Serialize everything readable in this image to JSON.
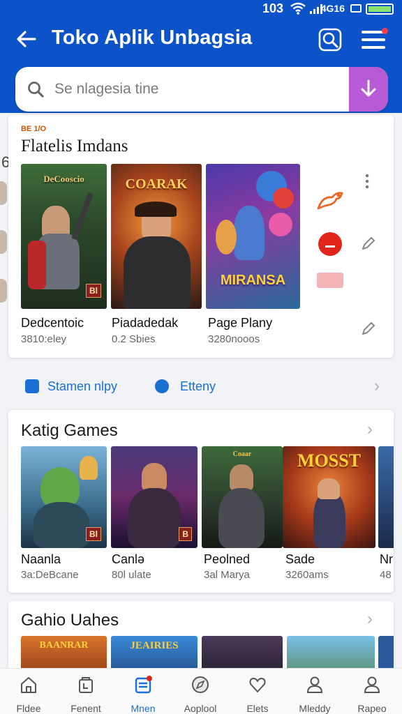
{
  "status_bar": {
    "time": "103",
    "network": "4G16"
  },
  "header": {
    "title": "Toko Aplik Unbagsia",
    "search_placeholder": "Se nlagesia tine"
  },
  "section_featured": {
    "tag": "BE 1/O",
    "title": "Flatelis Imdans",
    "apps": [
      {
        "name": "Dedcentoic",
        "sub": "3810:eley",
        "banner": "DeCooscio",
        "badge": "Bl"
      },
      {
        "name": "Piadadedak",
        "sub": "0.2 Sbies",
        "banner": "COARAK"
      },
      {
        "name": "Page Plany",
        "sub": "3280nooos",
        "banner": "MIRANSA"
      }
    ]
  },
  "tabs": [
    {
      "label": "Stamen nlpy"
    },
    {
      "label": "Etteny"
    }
  ],
  "section_games": {
    "title": "Katig Games",
    "apps": [
      {
        "name": "Naanla",
        "sub": "3a:DeBcane",
        "badge": "Bl"
      },
      {
        "name": "Canlə",
        "sub": "80l ulate",
        "badge": "B"
      },
      {
        "name": "Peolned",
        "sub": "3al Marya",
        "banner": "Coaar"
      },
      {
        "name": "Sade",
        "sub": "3260ams",
        "banner": "MOSST"
      },
      {
        "name": "Nr",
        "sub": "48"
      }
    ]
  },
  "section_gahio": {
    "title": "Gahio Uahes",
    "tiles": [
      {
        "banner": "BAANRAR"
      },
      {
        "banner": "JEAIRIES"
      },
      {
        "banner": ""
      },
      {
        "banner": ""
      }
    ]
  },
  "bottom_nav": [
    {
      "label": "Fldee",
      "icon": "home-icon"
    },
    {
      "label": "Fenent",
      "icon": "cart-icon"
    },
    {
      "label": "Mnen",
      "icon": "apps-icon",
      "active": true
    },
    {
      "label": "Aoplool",
      "icon": "compass-icon"
    },
    {
      "label": "Elets",
      "icon": "heart-icon"
    },
    {
      "label": "Mleddy",
      "icon": "people-icon"
    },
    {
      "label": "Rapeo",
      "icon": "profile-icon"
    }
  ],
  "colors": {
    "header": "#0c53c9",
    "accent_purple": "#b85ad6",
    "accent_blue": "#1a6fd4",
    "red": "#e0261b"
  }
}
